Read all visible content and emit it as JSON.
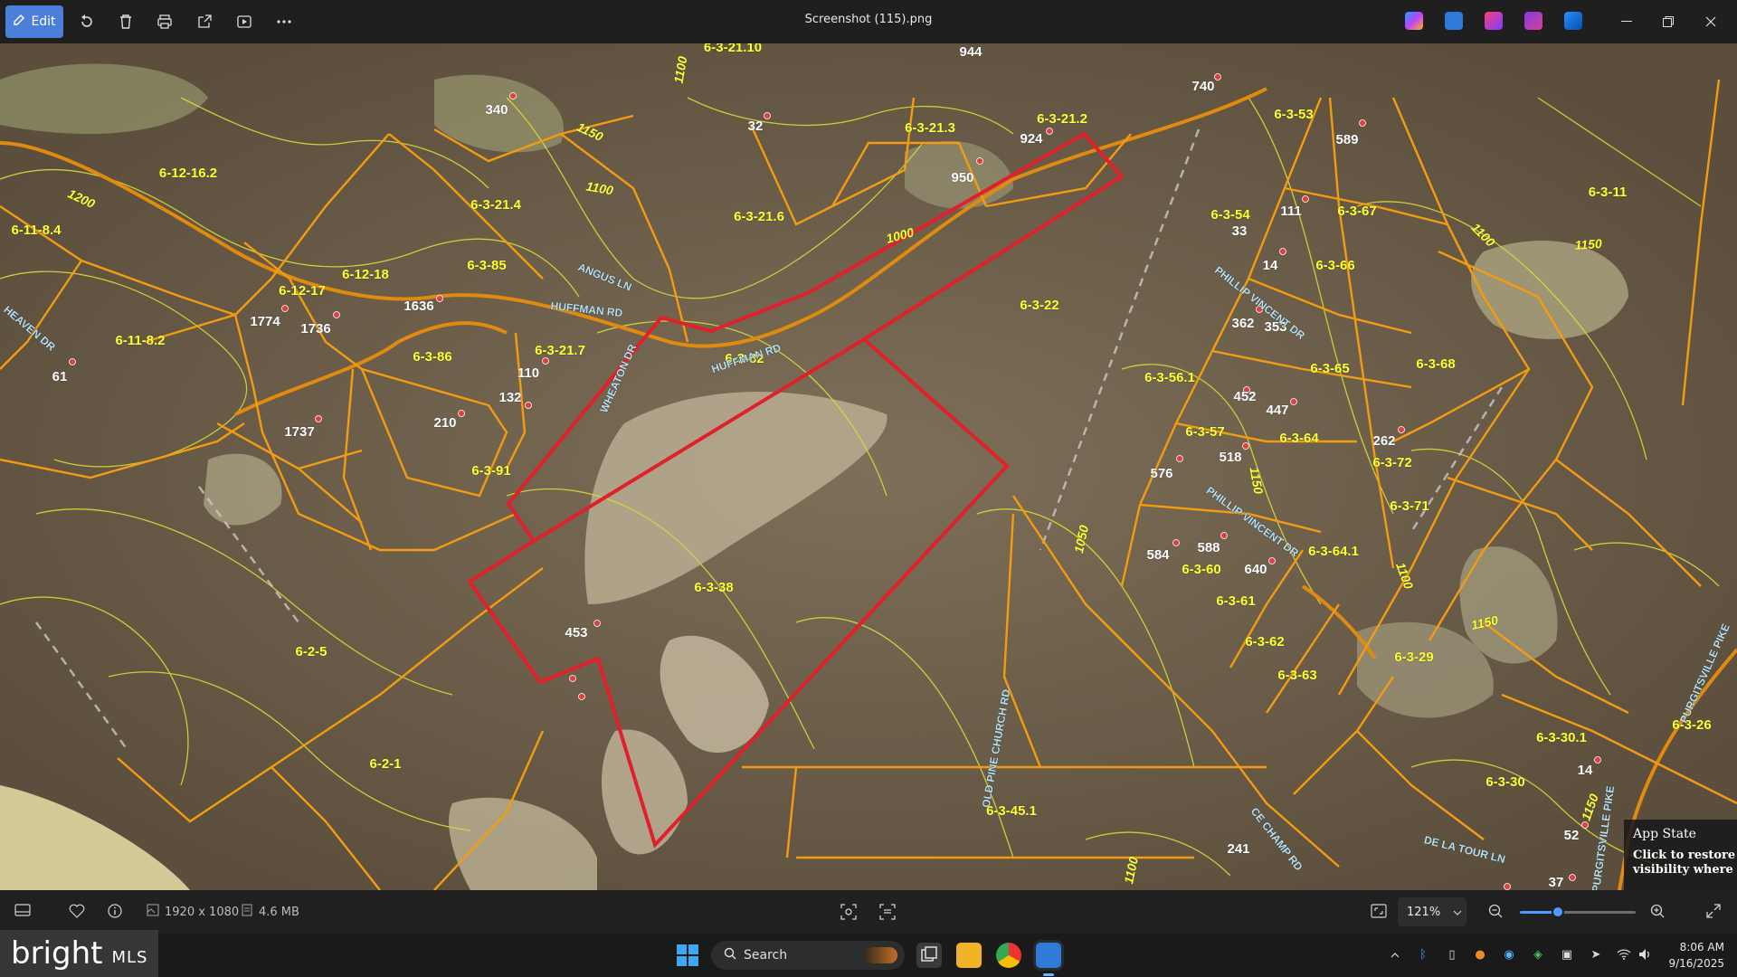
{
  "window": {
    "title": "Screenshot (115).png",
    "edit_label": "Edit",
    "minimize_icon": "minimize-icon",
    "restore_icon": "restore-icon",
    "close_icon": "close-icon"
  },
  "statusbar": {
    "dimensions": "1920 x 1080",
    "filesize": "4.6 MB",
    "zoom": "121%",
    "zoom_level": 0.33
  },
  "map": {
    "parcels": [
      {
        "id": "p1",
        "label": "6-3-21.10"
      },
      {
        "id": "p2",
        "label": "944"
      },
      {
        "id": "p3",
        "label": "740"
      },
      {
        "id": "p4",
        "label": "6-3-53"
      },
      {
        "id": "p5",
        "label": "340"
      },
      {
        "id": "p6",
        "label": "32"
      },
      {
        "id": "p7",
        "label": "6-3-21.3"
      },
      {
        "id": "p8",
        "label": "6-3-21.2"
      },
      {
        "id": "p9",
        "label": "924"
      },
      {
        "id": "p10",
        "label": "589"
      },
      {
        "id": "p11",
        "label": "950"
      },
      {
        "id": "p12",
        "label": "6-12-16.2"
      },
      {
        "id": "p13",
        "label": "6-3-21.4"
      },
      {
        "id": "p14",
        "label": "6-3-21.6"
      },
      {
        "id": "p15",
        "label": "6-3-54"
      },
      {
        "id": "p16",
        "label": "111"
      },
      {
        "id": "p17",
        "label": "6-3-67"
      },
      {
        "id": "p18",
        "label": "6-3-11"
      },
      {
        "id": "p19",
        "label": "6-11-8.4"
      },
      {
        "id": "p20",
        "label": "33"
      },
      {
        "id": "p21",
        "label": "14"
      },
      {
        "id": "p22",
        "label": "6-3-66"
      },
      {
        "id": "p23",
        "label": "6-12-17"
      },
      {
        "id": "p24",
        "label": "6-12-18"
      },
      {
        "id": "p25",
        "label": "6-3-85"
      },
      {
        "id": "p26",
        "label": "6-3-22"
      },
      {
        "id": "p27",
        "label": "1636"
      },
      {
        "id": "p28",
        "label": "1774"
      },
      {
        "id": "p29",
        "label": "1736"
      },
      {
        "id": "p30",
        "label": "362"
      },
      {
        "id": "p31",
        "label": "353"
      },
      {
        "id": "p32",
        "label": "6-11-8.2"
      },
      {
        "id": "p33",
        "label": "6-3-21.7"
      },
      {
        "id": "p34",
        "label": "6-3-82"
      },
      {
        "id": "p35",
        "label": "6-3-86"
      },
      {
        "id": "p36",
        "label": "6-3-65"
      },
      {
        "id": "p37",
        "label": "6-3-68"
      },
      {
        "id": "p38",
        "label": "61"
      },
      {
        "id": "p39",
        "label": "110"
      },
      {
        "id": "p40",
        "label": "6-3-56.1"
      },
      {
        "id": "p41",
        "label": "132"
      },
      {
        "id": "p42",
        "label": "452"
      },
      {
        "id": "p43",
        "label": "447"
      },
      {
        "id": "p44",
        "label": "210"
      },
      {
        "id": "p45",
        "label": "1737"
      },
      {
        "id": "p46",
        "label": "6-3-57"
      },
      {
        "id": "p47",
        "label": "6-3-64"
      },
      {
        "id": "p48",
        "label": "262"
      },
      {
        "id": "p49",
        "label": "518"
      },
      {
        "id": "p50",
        "label": "6-3-91"
      },
      {
        "id": "p51",
        "label": "576"
      },
      {
        "id": "p52",
        "label": "6-3-72"
      },
      {
        "id": "p53",
        "label": "6-3-71"
      },
      {
        "id": "p54",
        "label": "584"
      },
      {
        "id": "p55",
        "label": "588"
      },
      {
        "id": "p56",
        "label": "6-3-64.1"
      },
      {
        "id": "p57",
        "label": "6-3-60"
      },
      {
        "id": "p58",
        "label": "640"
      },
      {
        "id": "p59",
        "label": "6-3-38"
      },
      {
        "id": "p60",
        "label": "6-3-61"
      },
      {
        "id": "p61",
        "label": "453"
      },
      {
        "id": "p62",
        "label": "6-2-5"
      },
      {
        "id": "p63",
        "label": "6-3-62"
      },
      {
        "id": "p64",
        "label": "6-3-29"
      },
      {
        "id": "p65",
        "label": "6-3-63"
      },
      {
        "id": "p66",
        "label": "6-3-26"
      },
      {
        "id": "p67",
        "label": "6-3-30.1"
      },
      {
        "id": "p68",
        "label": "6-2-1"
      },
      {
        "id": "p69",
        "label": "14"
      },
      {
        "id": "p70",
        "label": "6-3-30"
      },
      {
        "id": "p71",
        "label": "6-3-45.1"
      },
      {
        "id": "p72",
        "label": "52"
      },
      {
        "id": "p73",
        "label": "241"
      },
      {
        "id": "p74",
        "label": "37"
      }
    ],
    "roads": [
      {
        "id": "r1",
        "label": "ANGUS LN"
      },
      {
        "id": "r2",
        "label": "HUFFMAN RD"
      },
      {
        "id": "r3",
        "label": "HUFFMAN RD"
      },
      {
        "id": "r4",
        "label": "WHEATON DR"
      },
      {
        "id": "r5",
        "label": "HEAVEN DR"
      },
      {
        "id": "r6",
        "label": "PHILLIP VINCENT DR"
      },
      {
        "id": "r7",
        "label": "PHILLIP VINCENT DR"
      },
      {
        "id": "r8",
        "label": "OLD PINE CHURCH RD"
      },
      {
        "id": "r9",
        "label": "CE CHAMP RD"
      },
      {
        "id": "r10",
        "label": "DE LA TOUR LN"
      },
      {
        "id": "r11",
        "label": "PURGITSVILLE PIKE"
      },
      {
        "id": "r12",
        "label": "PURGITSVILLE PIKE"
      }
    ],
    "contours": [
      {
        "id": "c1",
        "label": "1100"
      },
      {
        "id": "c2",
        "label": "1150"
      },
      {
        "id": "c3",
        "label": "1100"
      },
      {
        "id": "c4",
        "label": "1000"
      },
      {
        "id": "c5",
        "label": "1200"
      },
      {
        "id": "c6",
        "label": "1100"
      },
      {
        "id": "c7",
        "label": "1150"
      },
      {
        "id": "c8",
        "label": "1050"
      },
      {
        "id": "c9",
        "label": "1150"
      },
      {
        "id": "c10",
        "label": "1100"
      },
      {
        "id": "c11",
        "label": "1150"
      },
      {
        "id": "c12",
        "label": "1100"
      },
      {
        "id": "c13",
        "label": "1150"
      }
    ]
  },
  "overlay": {
    "brand": "bright",
    "brand_suffix": "MLS",
    "app_state_title": "App State",
    "app_state_line1": "Click to restore the",
    "app_state_line2": "visibility where you"
  },
  "taskbar": {
    "search_placeholder": "Search",
    "time": "8:06 AM",
    "date": "9/16/2025"
  },
  "colors": {
    "accent": "#4c7fd9",
    "parcel_line": "#f39c12",
    "subject_boundary": "#e0202a",
    "contour": "#d6d63a",
    "label_yellow": "#ffff33",
    "label_white": "#ffffff",
    "road_label": "#b8e0f0"
  }
}
